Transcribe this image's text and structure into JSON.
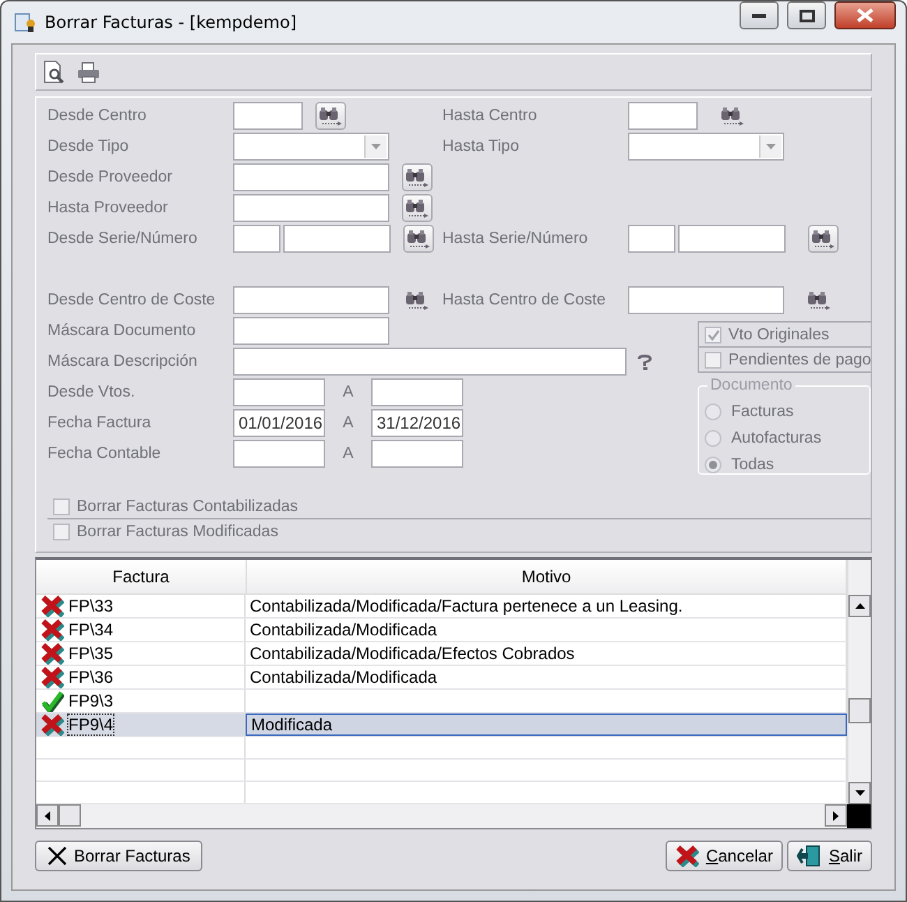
{
  "window": {
    "title": "Borrar Facturas - [kempdemo]"
  },
  "toolbar": [
    {
      "kind": "preview"
    },
    {
      "kind": "print"
    }
  ],
  "top_rows": [
    {
      "left": {
        "label": "Desde Centro",
        "kind": "short",
        "lookup": {
          "kind": "button"
        }
      },
      "right": {
        "label": "Hasta Centro",
        "kind": "short",
        "lookup": {
          "kind": "icon"
        }
      }
    },
    {
      "left": {
        "label": "Desde Tipo",
        "kind": "dropdown"
      },
      "right": {
        "label": "Hasta Tipo",
        "kind": "dropdown"
      }
    },
    {
      "left": {
        "label": "Desde Proveedor",
        "kind": "text",
        "lookup": {
          "kind": "button"
        }
      }
    },
    {
      "left": {
        "label": "Hasta Proveedor",
        "kind": "text",
        "lookup": {
          "kind": "button"
        }
      }
    },
    {
      "left": {
        "label": "Desde Serie/Número",
        "kind": "serie",
        "lookup": {
          "kind": "button"
        }
      },
      "right": {
        "label": "Hasta Serie/Número",
        "kind": "serie",
        "lookup": {
          "kind": "button"
        }
      }
    },
    {
      "left": {
        "label": "Desde Centro de Coste",
        "kind": "text",
        "lookup": {
          "kind": "icon"
        }
      },
      "right": {
        "label": "Hasta Centro de Coste",
        "kind": "text",
        "lookup": {
          "kind": "icon"
        }
      }
    }
  ],
  "lower_rows": [
    {
      "label": "Máscara Documento",
      "kind": "text"
    },
    {
      "label": "Máscara Descripción",
      "kind": "wide",
      "lookup": {
        "kind": "help"
      }
    },
    {
      "label": "Desde Vtos.",
      "kind": "range",
      "separator": "A"
    },
    {
      "label": "Fecha Factura",
      "kind": "range",
      "separator": "A",
      "from": "01/01/2016",
      "to": "31/12/2016"
    },
    {
      "label": "Fecha Contable",
      "kind": "range",
      "separator": "A"
    }
  ],
  "options": [
    {
      "label": "Vto Originales",
      "checked": true
    },
    {
      "label": "Pendientes de pago",
      "checked": false
    }
  ],
  "documento": {
    "legend": "Documento",
    "choices": [
      {
        "label": "Facturas",
        "selected": false
      },
      {
        "label": "Autofacturas",
        "selected": false
      },
      {
        "label": "Todas",
        "selected": true
      }
    ]
  },
  "delete_options": [
    {
      "label": "Borrar Facturas Contabilizadas",
      "checked": false
    },
    {
      "label": "Borrar Facturas Modificadas",
      "checked": false
    }
  ],
  "table": {
    "columns": [
      "Factura",
      "Motivo"
    ],
    "rows": [
      {
        "kind": "error",
        "factura": "FP\\33",
        "motivo": "Contabilizada/Modificada/Factura pertenece a un Leasing.",
        "selected": false
      },
      {
        "kind": "error",
        "factura": "FP\\34",
        "motivo": "Contabilizada/Modificada",
        "selected": false
      },
      {
        "kind": "error",
        "factura": "FP\\35",
        "motivo": "Contabilizada/Modificada/Efectos Cobrados",
        "selected": false
      },
      {
        "kind": "error",
        "factura": "FP\\36",
        "motivo": "Contabilizada/Modificada",
        "selected": false
      },
      {
        "kind": "ok",
        "factura": "FP9\\3",
        "selected": false
      },
      {
        "kind": "error",
        "factura": "FP9\\4",
        "motivo": "Modificada",
        "selected": true
      }
    ]
  },
  "buttons": [
    {
      "label": "Borrar Facturas",
      "kind": "delete"
    },
    {
      "label": "Cancelar",
      "kind": "cancel"
    },
    {
      "label": "Salir",
      "kind": "exit"
    }
  ]
}
